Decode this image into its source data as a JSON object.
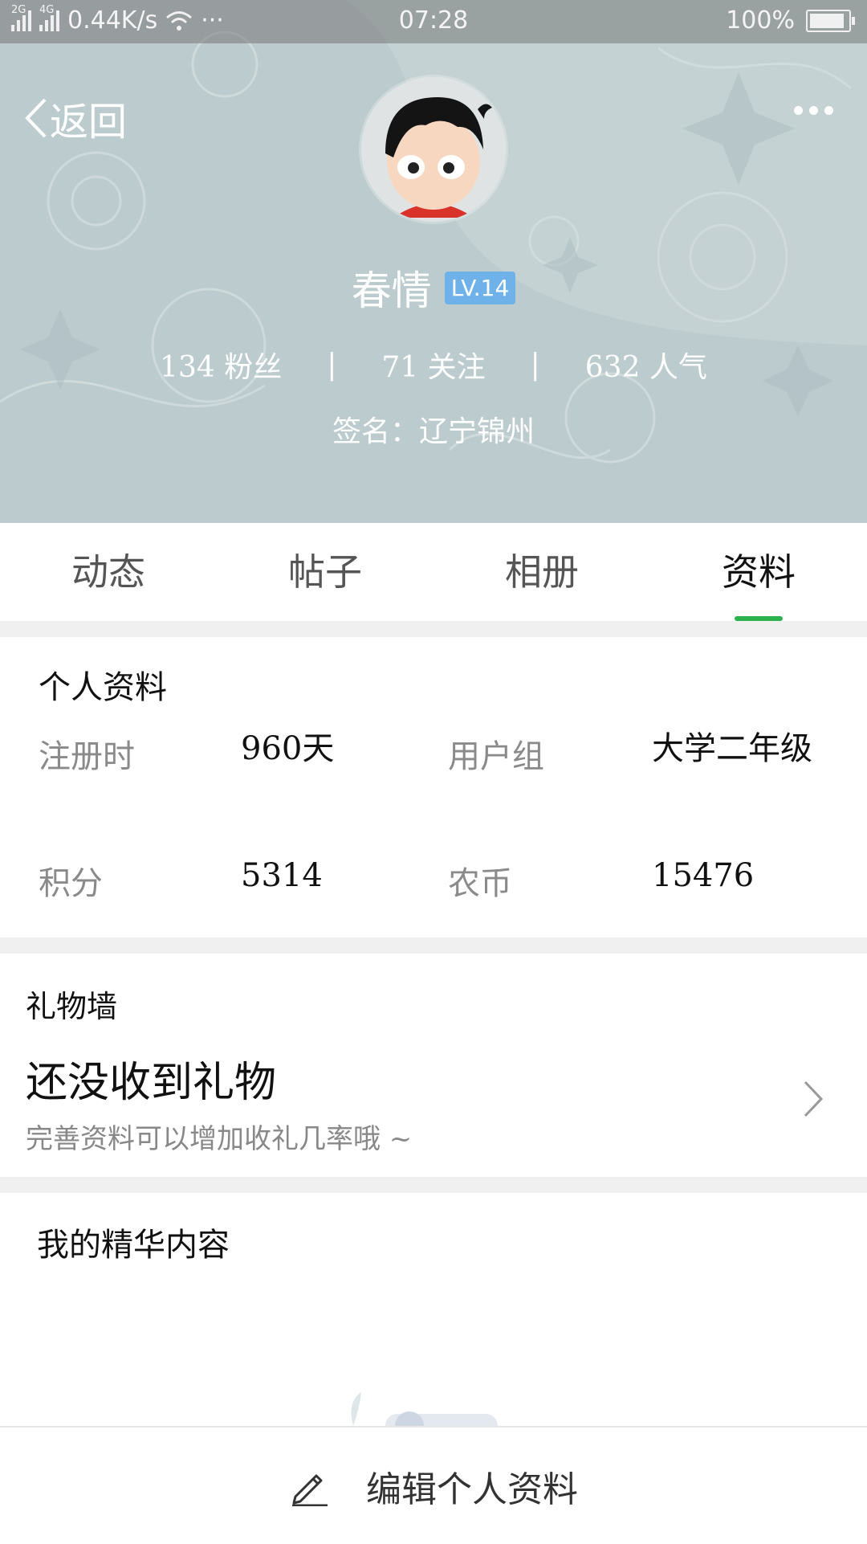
{
  "status_bar": {
    "network_1": "2G",
    "network_2": "4G",
    "speed": "0.44K/s",
    "dots": "···",
    "time": "07:28",
    "battery": "100%",
    "battery_level": 1.0
  },
  "header": {
    "back_label": "返回",
    "back_icon": "chevron-left-icon",
    "more_icon": "more-dots-icon"
  },
  "profile": {
    "name": "春情",
    "level": "LV.14",
    "fans": "134 粉丝",
    "following": "71 关注",
    "popularity": "632 人气",
    "separator": "|",
    "signature": "签名：辽宁锦州"
  },
  "tabs": [
    {
      "label": "动态"
    },
    {
      "label": "帖子"
    },
    {
      "label": "相册"
    },
    {
      "label": "资料"
    }
  ],
  "active_tab": "资料",
  "personal_info": {
    "title": "个人资料",
    "register_label": "注册时",
    "register_value": "960天",
    "group_label": "用户组",
    "group_value": "大学二年级",
    "points_label": "积分",
    "points_value": "5314",
    "coins_label": "农币",
    "coins_value": "15476"
  },
  "gift_wall": {
    "title": "礼物墙",
    "empty_text": "还没收到礼物",
    "hint": "完善资料可以增加收礼几率哦 ~"
  },
  "featured": {
    "title": "我的精华内容"
  },
  "bottom": {
    "edit_label": "编辑个人资料",
    "edit_icon": "pencil-icon"
  },
  "colors": {
    "accent": "#2bb24c",
    "level_badge": "#6fb2ea",
    "banner": "#bfcdd0"
  }
}
